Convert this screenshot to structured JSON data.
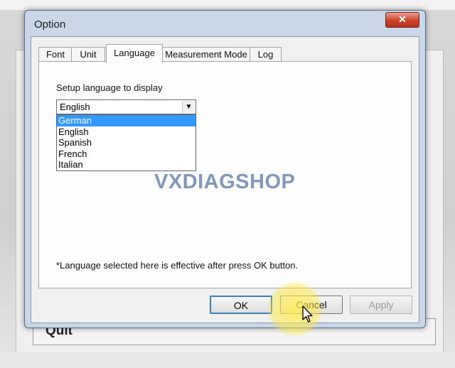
{
  "background": {
    "quit_label": "Quit"
  },
  "window": {
    "title": "Option",
    "close_glyph": "✕"
  },
  "tabs": [
    {
      "label": "Font",
      "active": false
    },
    {
      "label": "Unit",
      "active": false
    },
    {
      "label": "Language",
      "active": true
    },
    {
      "label": "Measurement Mode",
      "active": false
    },
    {
      "label": "Log",
      "active": false
    }
  ],
  "language_tab": {
    "setup_label": "Setup language to display",
    "combo_value": "English",
    "combo_arrow_glyph": "▼",
    "options": [
      "German",
      "English",
      "Spanish",
      "French",
      "Italian"
    ],
    "highlighted_option": "German",
    "note": "*Language selected here is effective after press OK button."
  },
  "buttons": {
    "ok": "OK",
    "cancel": "Cancel",
    "apply": "Apply"
  },
  "watermark": "VXDIAGSHOP",
  "colors": {
    "selection": "#3399ff",
    "close_button": "#c8422b",
    "cursor_highlight": "#ffee50"
  }
}
